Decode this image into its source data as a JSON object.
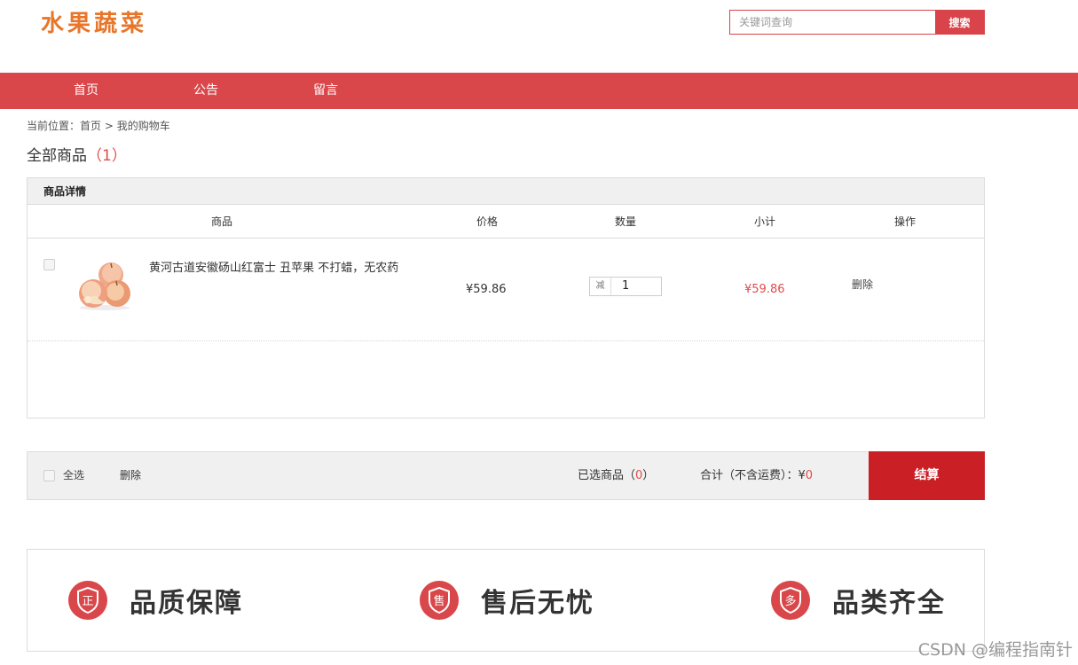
{
  "header": {
    "logo_text": "水果蔬菜",
    "search_placeholder": "关键词查询",
    "search_button": "搜索"
  },
  "nav": {
    "items": [
      "首页",
      "公告",
      "留言"
    ]
  },
  "breadcrumb": {
    "prefix": "当前位置：",
    "home": "首页",
    "separator": " > ",
    "current": "我的购物车"
  },
  "all_goods": {
    "label": "全部商品",
    "count_text": "（1）"
  },
  "cart": {
    "header": "商品详情",
    "columns": [
      "商品",
      "价格",
      "数量",
      "小计",
      "操作"
    ],
    "items": [
      {
        "name": "黄河古道安徽砀山红富士 丑苹果 不打蜡，无农药",
        "price": "¥59.86",
        "minus_label": "减",
        "quantity": "1",
        "subtotal": "¥59.86",
        "action": "删除"
      }
    ]
  },
  "footer_bar": {
    "select_all": "全选",
    "delete": "删除",
    "selected_label": "已选商品（",
    "selected_count": "0",
    "selected_suffix": "）",
    "total_label": "合计（不含运费）：¥",
    "total_value": "0",
    "checkout": "结算"
  },
  "features": [
    {
      "icon": "quality-icon",
      "icon_char": "正",
      "label": "品质保障"
    },
    {
      "icon": "after-sales-icon",
      "icon_char": "售",
      "label": "售后无忧"
    },
    {
      "icon": "variety-icon",
      "icon_char": "多",
      "label": "品类齐全"
    }
  ],
  "watermark": "CSDN @编程指南针",
  "colors": {
    "brand_red": "#d9474a",
    "checkout_red": "#cb1f26",
    "price_red": "#e24b4b",
    "logo_orange": "#e8762a"
  }
}
